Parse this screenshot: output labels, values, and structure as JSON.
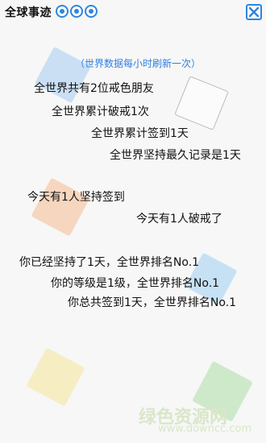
{
  "header": {
    "title": "全球事迹",
    "pager_dots": 3,
    "close_icon": "close-icon"
  },
  "subtitle": "（世界数据每小时刷新一次）",
  "lines": [
    "全世界共有2位戒色朋友",
    "全世界累计破戒1次",
    "全世界累计签到1天",
    "全世界坚持最久记录是1天",
    "今天有1人坚持签到",
    "今天有1人破戒了",
    "你已经坚持了1天，全世界排名No.1",
    "你的等级是1级，全世界排名No.1",
    "你总共签到1天，全世界排名No.1"
  ],
  "watermark": {
    "cn": "绿色资源网",
    "en": "www.downcc.com"
  },
  "colors": {
    "accent": "#2e86de",
    "subtitle": "#2f7fe0",
    "background": "#f7f7f7"
  }
}
